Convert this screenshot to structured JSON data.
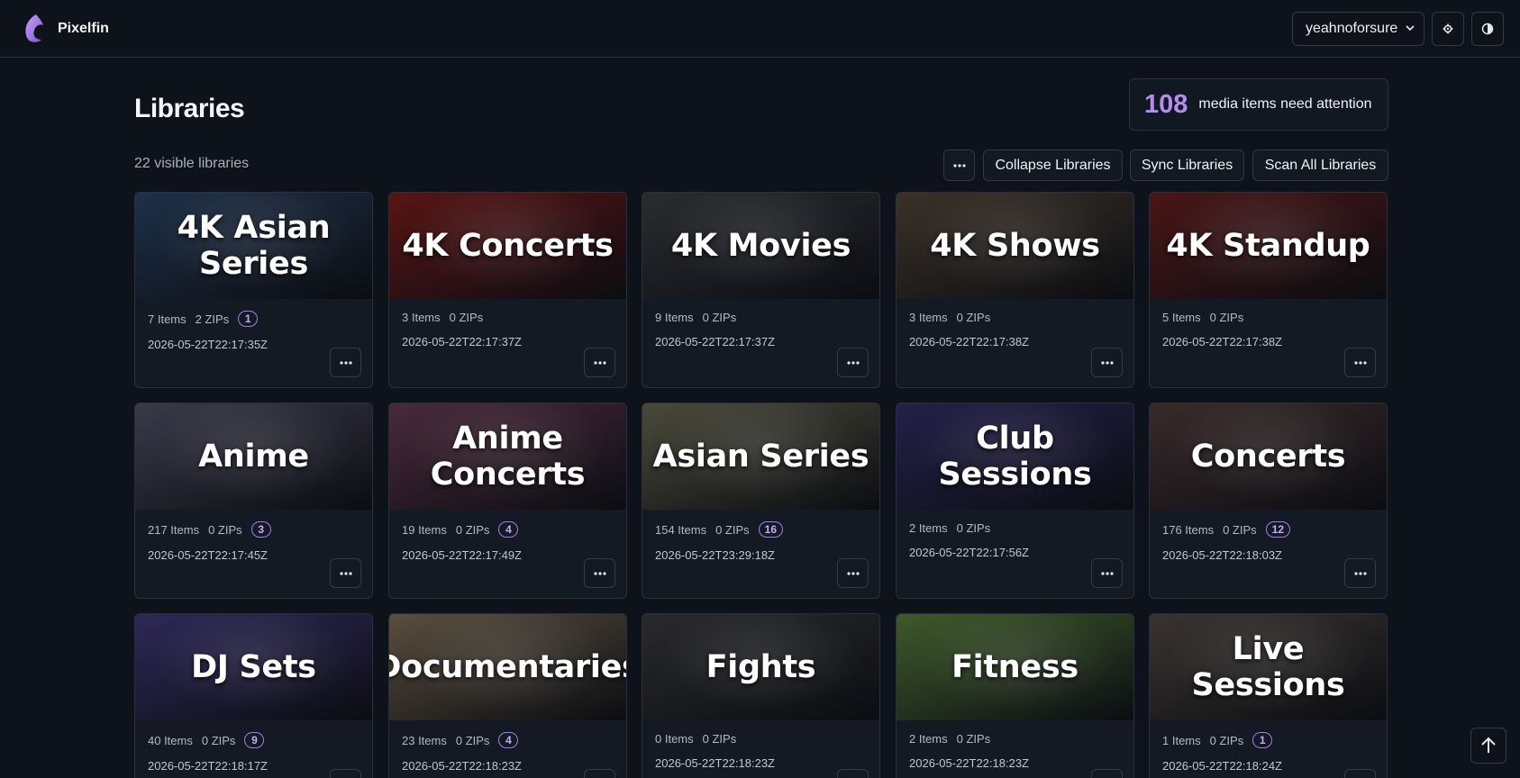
{
  "app": {
    "name": "Pixelfin"
  },
  "header": {
    "user": "yeahnoforsure",
    "settings_icon": "gear-icon",
    "theme_icon": "contrast-icon"
  },
  "page": {
    "title": "Libraries",
    "attention_count": "108",
    "attention_text": "media items need attention",
    "visible_count": "22 visible libraries",
    "more_label": "···",
    "collapse_label": "Collapse Libraries",
    "sync_label": "Sync Libraries",
    "scan_label": "Scan All Libraries"
  },
  "libraries": [
    {
      "title": "4K Asian Series",
      "items": "7 Items",
      "zips": "2 ZIPs",
      "badge": "1",
      "date": "2026-05-22T22:17:35Z",
      "bg": "#1e3048"
    },
    {
      "title": "4K Concerts",
      "items": "3 Items",
      "zips": "0 ZIPs",
      "badge": "",
      "date": "2026-05-22T22:17:37Z",
      "bg": "#5a1414"
    },
    {
      "title": "4K Movies",
      "items": "9 Items",
      "zips": "0 ZIPs",
      "badge": "",
      "date": "2026-05-22T22:17:37Z",
      "bg": "#2a2c30"
    },
    {
      "title": "4K Shows",
      "items": "3 Items",
      "zips": "0 ZIPs",
      "badge": "",
      "date": "2026-05-22T22:17:38Z",
      "bg": "#3b3127"
    },
    {
      "title": "4K Standup",
      "items": "5 Items",
      "zips": "0 ZIPs",
      "badge": "",
      "date": "2026-05-22T22:17:38Z",
      "bg": "#4a1616"
    },
    {
      "title": "Anime",
      "items": "217 Items",
      "zips": "0 ZIPs",
      "badge": "3",
      "date": "2026-05-22T22:17:45Z",
      "bg": "#3a3a4a"
    },
    {
      "title": "Anime Concerts",
      "items": "19 Items",
      "zips": "0 ZIPs",
      "badge": "4",
      "date": "2026-05-22T22:17:49Z",
      "bg": "#4a2a3a"
    },
    {
      "title": "Asian Series",
      "items": "154 Items",
      "zips": "0 ZIPs",
      "badge": "16",
      "date": "2026-05-22T23:29:18Z",
      "bg": "#4a4a3a"
    },
    {
      "title": "Club Sessions",
      "items": "2 Items",
      "zips": "0 ZIPs",
      "badge": "",
      "date": "2026-05-22T22:17:56Z",
      "bg": "#24204a"
    },
    {
      "title": "Concerts",
      "items": "176 Items",
      "zips": "0 ZIPs",
      "badge": "12",
      "date": "2026-05-22T22:18:03Z",
      "bg": "#3a2a2a"
    },
    {
      "title": "DJ Sets",
      "items": "40 Items",
      "zips": "0 ZIPs",
      "badge": "9",
      "date": "2026-05-22T22:18:17Z",
      "bg": "#2e2858"
    },
    {
      "title": "Documentaries",
      "items": "23 Items",
      "zips": "0 ZIPs",
      "badge": "4",
      "date": "2026-05-22T22:18:23Z",
      "bg": "#5a4e3e"
    },
    {
      "title": "Fights",
      "items": "0 Items",
      "zips": "0 ZIPs",
      "badge": "",
      "date": "2026-05-22T22:18:23Z",
      "bg": "#2a2a2c"
    },
    {
      "title": "Fitness",
      "items": "2 Items",
      "zips": "0 ZIPs",
      "badge": "",
      "date": "2026-05-22T22:18:23Z",
      "bg": "#3e5a2a"
    },
    {
      "title": "Live Sessions",
      "items": "1 Items",
      "zips": "0 ZIPs",
      "badge": "1",
      "date": "2026-05-22T22:18:24Z",
      "bg": "#3a3430"
    }
  ]
}
